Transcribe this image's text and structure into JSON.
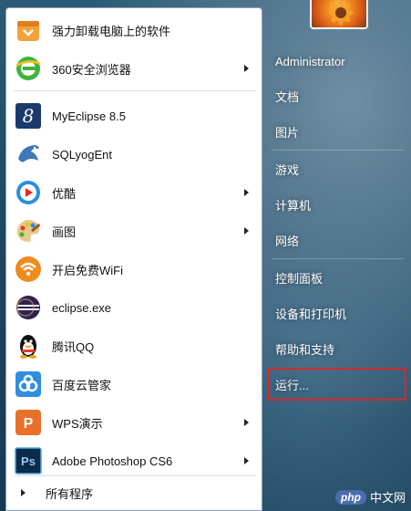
{
  "programs": [
    {
      "label": "强力卸载电脑上的软件",
      "icon": "uninstaller-icon",
      "has_submenu": false
    },
    {
      "label": "360安全浏览器",
      "icon": "360-browser-icon",
      "has_submenu": true
    },
    {
      "label": "MyEclipse 8.5",
      "icon": "myeclipse-icon",
      "has_submenu": false
    },
    {
      "label": "SQLyogEnt",
      "icon": "sqlyog-dolphin-icon",
      "has_submenu": false
    },
    {
      "label": "优酷",
      "icon": "youku-icon",
      "has_submenu": true
    },
    {
      "label": "画图",
      "icon": "paint-palette-icon",
      "has_submenu": true
    },
    {
      "label": "开启免费WiFi",
      "icon": "wifi-icon",
      "has_submenu": false
    },
    {
      "label": "eclipse.exe",
      "icon": "eclipse-icon",
      "has_submenu": false
    },
    {
      "label": "腾讯QQ",
      "icon": "qq-penguin-icon",
      "has_submenu": false
    },
    {
      "label": "百度云管家",
      "icon": "baidu-cloud-icon",
      "has_submenu": false
    },
    {
      "label": "WPS演示",
      "icon": "wps-presentation-icon",
      "has_submenu": true
    },
    {
      "label": "Adobe Photoshop CS6",
      "icon": "photoshop-icon",
      "has_submenu": true
    }
  ],
  "all_programs_label": "所有程序",
  "right_menu": {
    "user": "Administrator",
    "items": [
      "文档",
      "图片",
      "游戏",
      "计算机",
      "网络",
      "控制面板",
      "设备和打印机",
      "帮助和支持",
      "运行..."
    ]
  },
  "watermark": {
    "badge": "php",
    "text": "中文网"
  },
  "colors": {
    "highlight_border": "#d8262c",
    "panel_bg": "#ffffff"
  }
}
